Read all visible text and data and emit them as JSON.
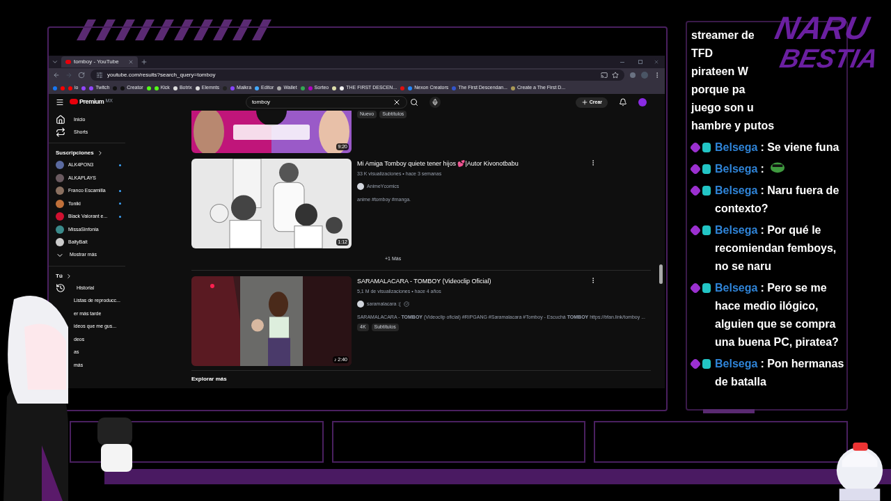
{
  "logo": {
    "line1": "NARU",
    "line2": "BESTIA"
  },
  "browser": {
    "tab": {
      "title": "tomboy - YouTube",
      "selected": true
    },
    "url": "youtube.com/results?search_query=tomboy",
    "bookmarks": [
      {
        "color": "#1877f2"
      },
      {
        "color": "#ff0000"
      },
      {
        "color": "#ff0000",
        "label": "io"
      },
      {
        "color": "#9146ff"
      },
      {
        "color": "#9146ff",
        "label": "Twitch"
      },
      {
        "color": "#111111"
      },
      {
        "color": "#111111",
        "label": "Creator"
      },
      {
        "color": "#53fc18"
      },
      {
        "color": "#53fc18",
        "label": "Kick"
      },
      {
        "color": "#dddddd",
        "label": "Botrix"
      },
      {
        "color": "#dddddd",
        "label": "Elemnts"
      },
      {
        "color": "#222222"
      },
      {
        "color": "#8844ff",
        "label": "Maikra"
      },
      {
        "color": "#44aaff",
        "label": "Editor"
      },
      {
        "color": "#aaaaaa",
        "label": "Wallet"
      },
      {
        "color": "#34a853"
      },
      {
        "color": "#b000c0",
        "label": "Sorteo"
      },
      {
        "color": "#ddddaa"
      },
      {
        "color": "#eeeeee",
        "label": "THE FIRST DESCEN..."
      },
      {
        "color": "#e01010"
      },
      {
        "color": "#2288ff",
        "label": "Nexon Creators"
      },
      {
        "color": "#3355cc",
        "label": "The First Descendan..."
      },
      {
        "color": "#aa9955",
        "label": "Create a The First D..."
      }
    ]
  },
  "youtube": {
    "brand": "Premium",
    "region": "MX",
    "search": "tomboy",
    "create": "Crear",
    "nav": [
      "Inicio",
      "Shorts"
    ],
    "subscriptions_title": "Suscripciones",
    "subscriptions": [
      {
        "name": "ALK4PON3",
        "new": true,
        "color": "#5a6aa0"
      },
      {
        "name": "ALKAPLAYS",
        "new": false,
        "color": "#6a5a60"
      },
      {
        "name": "Franco Escamilla",
        "new": true,
        "color": "#8a7060"
      },
      {
        "name": "Toniki",
        "new": true,
        "color": "#c0703a"
      },
      {
        "name": "Black Valorant e...",
        "new": true,
        "color": "#d01030"
      },
      {
        "name": "MissaSinfonia",
        "new": false,
        "color": "#3a8a8a"
      },
      {
        "name": "BaityBait",
        "new": false,
        "color": "#cccccc"
      }
    ],
    "show_more": "Mostrar más",
    "you_title": "Tú",
    "you": [
      "Historial",
      "Listas de reproducc...",
      "er más tarde",
      "ideos que me gus...",
      "deos",
      "as",
      "más"
    ],
    "partial_badges": [
      "Nuevo",
      "Subtítulos"
    ],
    "partial_duration": "9:20",
    "videos": [
      {
        "title": "Mi Amiga Tomboy quiete tener hijos 💕|Autor Kivonotbabu",
        "meta": "33 K visualizaciones • hace 3 semanas",
        "channel": "AnimeYcomics",
        "verified": false,
        "desc": "anime #tomboy #manga.",
        "duration": "1:12",
        "more": "+1 Más",
        "kind": "drawing"
      },
      {
        "title": "SARAMALACARA - TOMBOY (Videoclip Oficial)",
        "meta": "5,1 M de visualizaciones • hace 4 años",
        "channel": "saramalacara :(",
        "verified": true,
        "desc": "SARAMALACARA - **TOMBOY** (Videoclip oficial) #RIPGANG #Saramalacara #Tomboy - Escuchá **TOMBOY** https://bfan.link/tomboy ...",
        "duration": "♪ 2:40",
        "badges": [
          "4K",
          "Subtítulos"
        ]
      }
    ],
    "explore": "Explorar más"
  },
  "chat": {
    "fragments": [
      "streamer de",
      "TFD",
      "pirateen W",
      "porque pa",
      "juego son u",
      "hambre y putos"
    ],
    "messages": [
      {
        "user": "Belsega",
        "text": ": Se viene funa",
        "emote": false
      },
      {
        "user": "Belsega",
        "text": ":",
        "emote": true
      },
      {
        "user": "Belsega",
        "text": ": Naru fuera de contexto?",
        "emote": false
      },
      {
        "user": "Belsega",
        "text": ": Por qué le recomiendan femboys, no se naru",
        "emote": false
      },
      {
        "user": "Belsega",
        "text": ": Pero se me hace medio ilógico, alguien que se compra una buena PC, piratea?",
        "emote": false
      },
      {
        "user": "Belsega",
        "text": ": Pon hermanas de batalla",
        "emote": false
      }
    ]
  }
}
